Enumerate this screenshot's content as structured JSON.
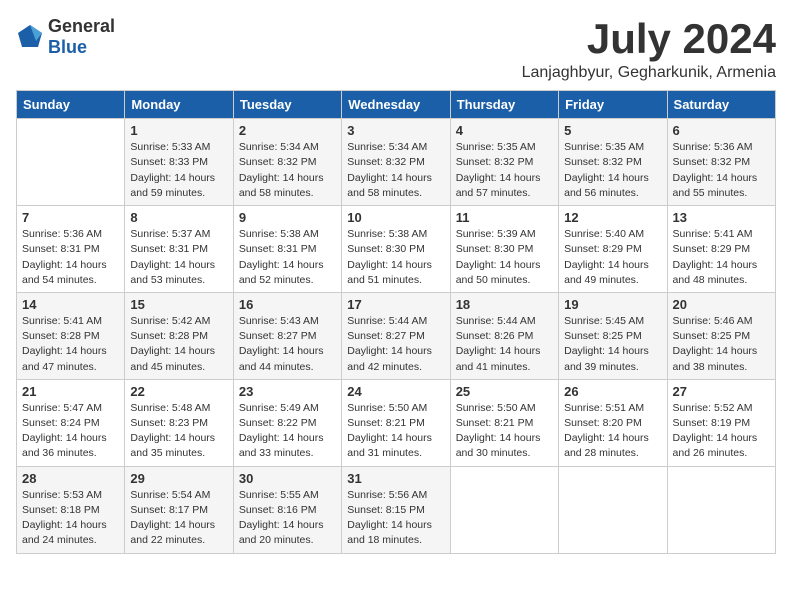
{
  "logo": {
    "general": "General",
    "blue": "Blue"
  },
  "header": {
    "month": "July 2024",
    "location": "Lanjaghbyur, Gegharkunik, Armenia"
  },
  "weekdays": [
    "Sunday",
    "Monday",
    "Tuesday",
    "Wednesday",
    "Thursday",
    "Friday",
    "Saturday"
  ],
  "weeks": [
    [
      {
        "day": "",
        "info": ""
      },
      {
        "day": "1",
        "info": "Sunrise: 5:33 AM\nSunset: 8:33 PM\nDaylight: 14 hours\nand 59 minutes."
      },
      {
        "day": "2",
        "info": "Sunrise: 5:34 AM\nSunset: 8:32 PM\nDaylight: 14 hours\nand 58 minutes."
      },
      {
        "day": "3",
        "info": "Sunrise: 5:34 AM\nSunset: 8:32 PM\nDaylight: 14 hours\nand 58 minutes."
      },
      {
        "day": "4",
        "info": "Sunrise: 5:35 AM\nSunset: 8:32 PM\nDaylight: 14 hours\nand 57 minutes."
      },
      {
        "day": "5",
        "info": "Sunrise: 5:35 AM\nSunset: 8:32 PM\nDaylight: 14 hours\nand 56 minutes."
      },
      {
        "day": "6",
        "info": "Sunrise: 5:36 AM\nSunset: 8:32 PM\nDaylight: 14 hours\nand 55 minutes."
      }
    ],
    [
      {
        "day": "7",
        "info": "Sunrise: 5:36 AM\nSunset: 8:31 PM\nDaylight: 14 hours\nand 54 minutes."
      },
      {
        "day": "8",
        "info": "Sunrise: 5:37 AM\nSunset: 8:31 PM\nDaylight: 14 hours\nand 53 minutes."
      },
      {
        "day": "9",
        "info": "Sunrise: 5:38 AM\nSunset: 8:31 PM\nDaylight: 14 hours\nand 52 minutes."
      },
      {
        "day": "10",
        "info": "Sunrise: 5:38 AM\nSunset: 8:30 PM\nDaylight: 14 hours\nand 51 minutes."
      },
      {
        "day": "11",
        "info": "Sunrise: 5:39 AM\nSunset: 8:30 PM\nDaylight: 14 hours\nand 50 minutes."
      },
      {
        "day": "12",
        "info": "Sunrise: 5:40 AM\nSunset: 8:29 PM\nDaylight: 14 hours\nand 49 minutes."
      },
      {
        "day": "13",
        "info": "Sunrise: 5:41 AM\nSunset: 8:29 PM\nDaylight: 14 hours\nand 48 minutes."
      }
    ],
    [
      {
        "day": "14",
        "info": "Sunrise: 5:41 AM\nSunset: 8:28 PM\nDaylight: 14 hours\nand 47 minutes."
      },
      {
        "day": "15",
        "info": "Sunrise: 5:42 AM\nSunset: 8:28 PM\nDaylight: 14 hours\nand 45 minutes."
      },
      {
        "day": "16",
        "info": "Sunrise: 5:43 AM\nSunset: 8:27 PM\nDaylight: 14 hours\nand 44 minutes."
      },
      {
        "day": "17",
        "info": "Sunrise: 5:44 AM\nSunset: 8:27 PM\nDaylight: 14 hours\nand 42 minutes."
      },
      {
        "day": "18",
        "info": "Sunrise: 5:44 AM\nSunset: 8:26 PM\nDaylight: 14 hours\nand 41 minutes."
      },
      {
        "day": "19",
        "info": "Sunrise: 5:45 AM\nSunset: 8:25 PM\nDaylight: 14 hours\nand 39 minutes."
      },
      {
        "day": "20",
        "info": "Sunrise: 5:46 AM\nSunset: 8:25 PM\nDaylight: 14 hours\nand 38 minutes."
      }
    ],
    [
      {
        "day": "21",
        "info": "Sunrise: 5:47 AM\nSunset: 8:24 PM\nDaylight: 14 hours\nand 36 minutes."
      },
      {
        "day": "22",
        "info": "Sunrise: 5:48 AM\nSunset: 8:23 PM\nDaylight: 14 hours\nand 35 minutes."
      },
      {
        "day": "23",
        "info": "Sunrise: 5:49 AM\nSunset: 8:22 PM\nDaylight: 14 hours\nand 33 minutes."
      },
      {
        "day": "24",
        "info": "Sunrise: 5:50 AM\nSunset: 8:21 PM\nDaylight: 14 hours\nand 31 minutes."
      },
      {
        "day": "25",
        "info": "Sunrise: 5:50 AM\nSunset: 8:21 PM\nDaylight: 14 hours\nand 30 minutes."
      },
      {
        "day": "26",
        "info": "Sunrise: 5:51 AM\nSunset: 8:20 PM\nDaylight: 14 hours\nand 28 minutes."
      },
      {
        "day": "27",
        "info": "Sunrise: 5:52 AM\nSunset: 8:19 PM\nDaylight: 14 hours\nand 26 minutes."
      }
    ],
    [
      {
        "day": "28",
        "info": "Sunrise: 5:53 AM\nSunset: 8:18 PM\nDaylight: 14 hours\nand 24 minutes."
      },
      {
        "day": "29",
        "info": "Sunrise: 5:54 AM\nSunset: 8:17 PM\nDaylight: 14 hours\nand 22 minutes."
      },
      {
        "day": "30",
        "info": "Sunrise: 5:55 AM\nSunset: 8:16 PM\nDaylight: 14 hours\nand 20 minutes."
      },
      {
        "day": "31",
        "info": "Sunrise: 5:56 AM\nSunset: 8:15 PM\nDaylight: 14 hours\nand 18 minutes."
      },
      {
        "day": "",
        "info": ""
      },
      {
        "day": "",
        "info": ""
      },
      {
        "day": "",
        "info": ""
      }
    ]
  ]
}
